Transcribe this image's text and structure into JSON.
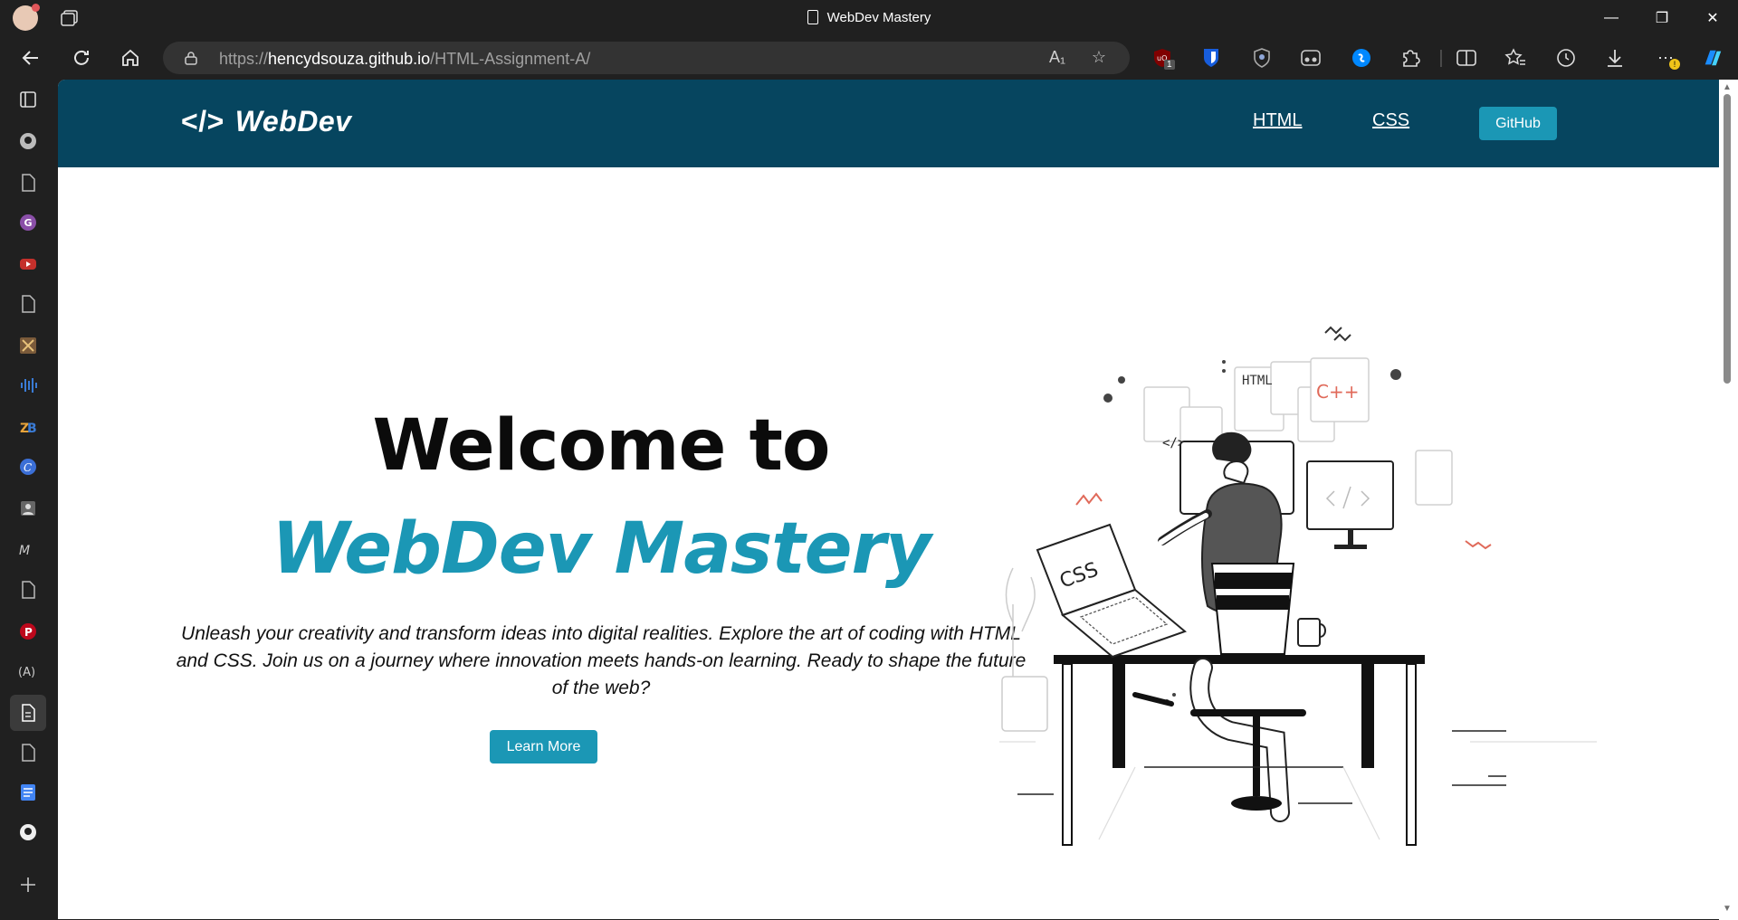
{
  "browser": {
    "window_title": "WebDev Mastery",
    "url_prefix": "https://",
    "url_host": "hencydsouza.github.io",
    "url_path": "/HTML-Assignment-A/",
    "extensions": [
      "ublock-icon",
      "bitwarden-icon",
      "shield-extension-icon",
      "reader-extension-icon",
      "shazam-icon",
      "extensions-icon",
      "split-screen-icon",
      "favorites-icon",
      "history-icon",
      "downloads-icon",
      "more-icon",
      "copilot-icon"
    ],
    "ublock_badge": "1"
  },
  "sidebar": {
    "items": [
      "tabs-icon",
      "github-icon",
      "page-icon",
      "grammarly-icon",
      "youtube-icon",
      "page-icon",
      "game-icon",
      "audio-icon",
      "zotero-icon",
      "canva-icon",
      "contacts-icon",
      "medium-icon",
      "page-icon",
      "pinterest-icon",
      "formula-icon",
      "page-icon",
      "page-icon",
      "docs-icon",
      "github-icon",
      "add-icon"
    ]
  },
  "site": {
    "logo_symbol": "</>",
    "logo_text": "WebDev",
    "nav": {
      "html": "HTML",
      "css": "CSS",
      "github": "GitHub"
    },
    "hero": {
      "line1": "Welcome to",
      "line2": "WebDev Mastery",
      "description": "Unleash your creativity and transform ideas into digital realities. Explore the art of coding with HTML and CSS. Join us on a journey where innovation meets hands-on learning. Ready to shape the future of the web?",
      "cta": "Learn More"
    },
    "illustration": {
      "laptop_text": "CSS",
      "tag_text": "</>",
      "html_note": "HTML",
      "cpp_note": "C++"
    }
  },
  "colors": {
    "header_bg": "#06455f",
    "accent": "#1b97b5",
    "chrome_bg": "#202020"
  }
}
